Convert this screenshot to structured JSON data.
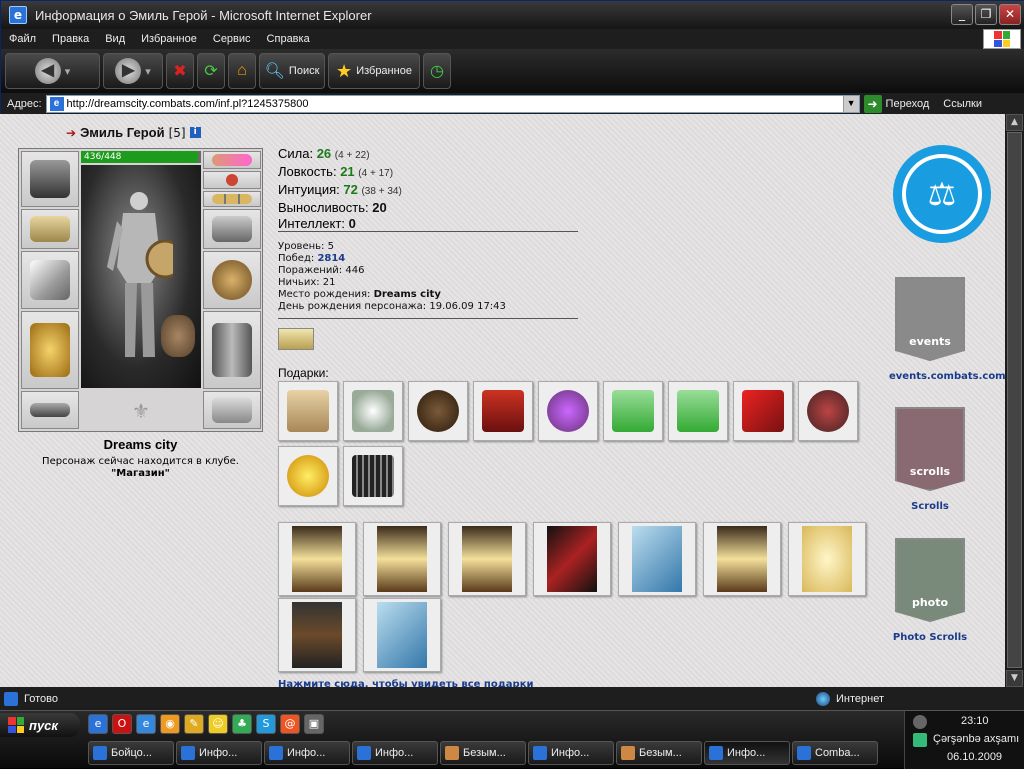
{
  "window": {
    "title": "Информация о Эмиль Герой - Microsoft Internet Explorer"
  },
  "menu": [
    "Файл",
    "Правка",
    "Вид",
    "Избранное",
    "Сервис",
    "Справка"
  ],
  "toolbar": {
    "search_label": "Поиск",
    "favorites_label": "Избранное"
  },
  "address": {
    "label": "Адрес:",
    "url": "http://dreamscity.combats.com/inf.pl?1245375800",
    "go_label": "Переход",
    "links_label": "Ссылки"
  },
  "character": {
    "name": "Эмиль Герой",
    "level_badge": "[5]",
    "hp": "436/448",
    "hp_fraction": 0.973,
    "city": "Dreams city",
    "location_line": "Персонаж сейчас находится в клубе.",
    "location_place": "\"Магазин\""
  },
  "stats": [
    {
      "label": "Сила:",
      "value": "26",
      "detail": "(4 + 22)"
    },
    {
      "label": "Ловкость:",
      "value": "21",
      "detail": "(4 + 17)"
    },
    {
      "label": "Интуиция:",
      "value": "72",
      "detail": "(38 + 34)"
    },
    {
      "label": "Выносливость:",
      "value": "20",
      "detail": ""
    },
    {
      "label": "Интеллект:",
      "value": "0",
      "detail": ""
    }
  ],
  "info": {
    "level_label": "Уровень:",
    "level": "5",
    "wins_label": "Побед:",
    "wins": "2814",
    "losses_label": "Поражений:",
    "losses": "446",
    "draws_label": "Ничьих:",
    "draws": "21",
    "birthplace_label": "Место рождения:",
    "birthplace": "Dreams city",
    "birthday_label": "День рождения персонажа:",
    "birthday": "19.06.09 17:43"
  },
  "gifts": {
    "title": "Подарки:",
    "more_link": "Нажмите сюда, чтобы увидеть все подарки"
  },
  "sidebar": {
    "events": "events.combats.com",
    "scrolls": "Scrolls",
    "photo": "Photo Scrolls",
    "events_word": "events",
    "scrolls_word": "scrolls",
    "photo_word": "photo"
  },
  "status": {
    "left": "Готово",
    "zone": "Интернет"
  },
  "taskbar": {
    "start": "пуск",
    "tasks": [
      "Бойцо...",
      "Инфо...",
      "Инфо...",
      "Инфо...",
      "Безым...",
      "Инфо...",
      "Безым...",
      "Инфо...",
      "Comba..."
    ],
    "time": "23:10",
    "day": "Çərşənbə axşamı",
    "date": "06.10.2009"
  },
  "colors": {
    "accent_blue": "#1a9de0",
    "hp_green": "#1c9b1c",
    "link_blue": "#1a3c8c",
    "stat_green": "#1b7a1b"
  }
}
